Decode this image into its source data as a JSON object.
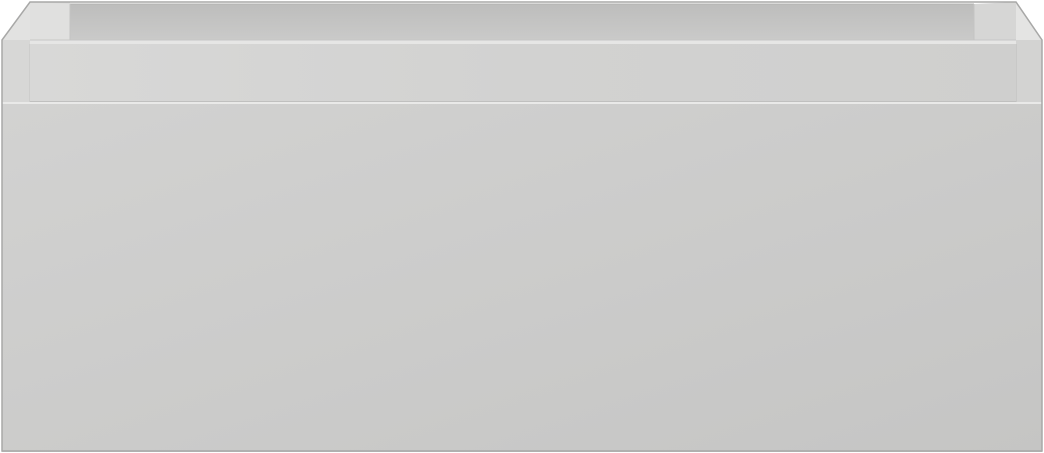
{
  "scene": {
    "subject": "",
    "colors": {
      "background": "#ffffff",
      "front_panel": "#cbcbca",
      "front_panel_light": "#d3d3d2",
      "front_panel_shadow": "#c6c6c5",
      "inner_back_wall": "#c4c4c3",
      "inner_side_wall": "#dadada",
      "rim_top": "#d0d0cf",
      "rim_face": "#d4d4d3",
      "edge_highlight": "#ececec",
      "edge_line": "#b8b8b7",
      "outline": "#a9a9a8"
    }
  }
}
